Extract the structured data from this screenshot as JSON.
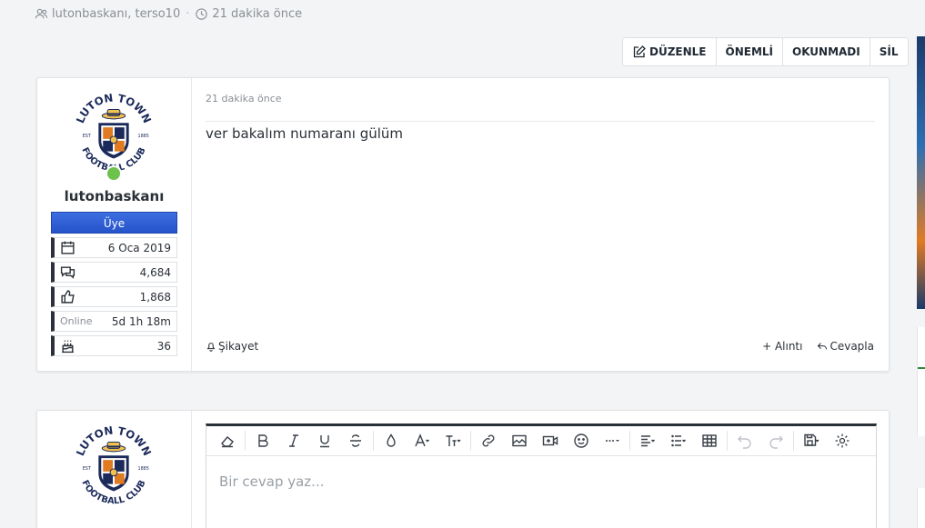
{
  "thread_meta": {
    "participants": "lutonbaskanı, terso10",
    "separator": "·",
    "time_ago": "21 dakika önce"
  },
  "actions": {
    "edit": "DÜZENLE",
    "important": "ÖNEMLİ",
    "unread": "OKUNMADI",
    "delete": "SİL"
  },
  "post": {
    "username": "lutonbaskanı",
    "role": "Üye",
    "stats": {
      "joined": "6 Oca 2019",
      "messages": "4,684",
      "reactions": "1,868",
      "online_label": "Online",
      "online_time": "5d 1h 18m",
      "age": "36"
    },
    "time": "21 dakika önce",
    "message": "ver bakalım numaranı gülüm",
    "report": "Şikayet",
    "quote": "+ Alıntı",
    "reply": "Cevapla"
  },
  "logo": {
    "top_text": "LUTON TOWN",
    "bottom_text": "FOOTBALL CLUB",
    "est": "EST",
    "year": "1885"
  },
  "editor": {
    "placeholder": "Bir cevap yaz..."
  },
  "colors": {
    "role_badge": "#2553c9",
    "online": "#6cc24a",
    "logo_navy": "#1b2a5a",
    "logo_orange": "#e07b22"
  }
}
